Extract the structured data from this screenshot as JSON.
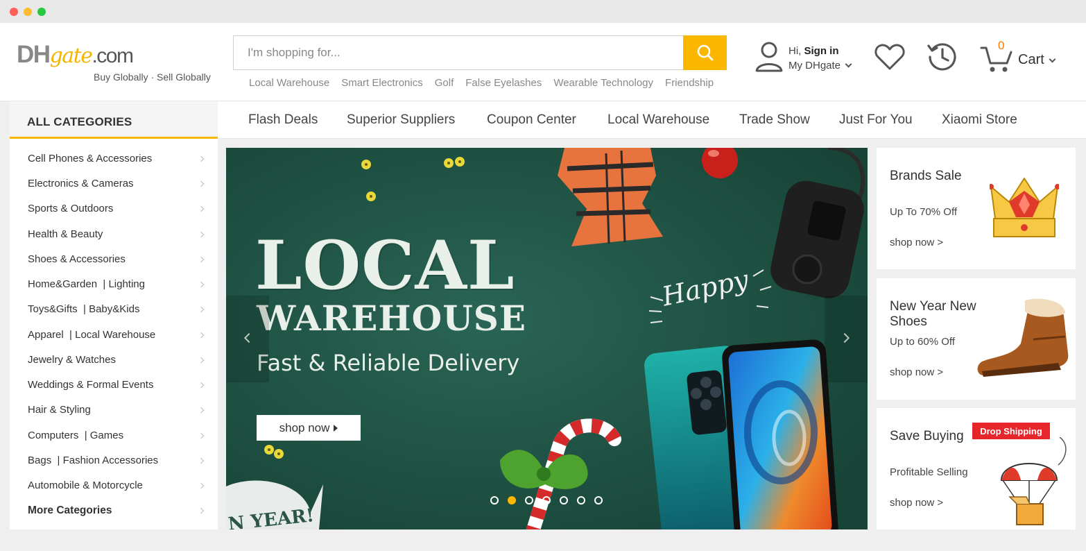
{
  "header": {
    "logo": {
      "dh": "DH",
      "gate": "gate",
      "com": ".com",
      "tagline": "Buy Globally · Sell Globally"
    },
    "search": {
      "placeholder": "I'm shopping for...",
      "value": ""
    },
    "quick_links": [
      "Local Warehouse",
      "Smart Electronics",
      "Golf",
      "False Eyelashes",
      "Wearable Technology",
      "Friendship"
    ],
    "account": {
      "greeting": "Hi, ",
      "sign_in": "Sign in",
      "my": "My DHgate"
    },
    "cart": {
      "count": "0",
      "label": "Cart"
    }
  },
  "categories": {
    "title": "ALL CATEGORIES",
    "items": [
      "Cell Phones & Accessories",
      "Electronics & Cameras",
      "Sports & Outdoors",
      "Health & Beauty",
      "Shoes & Accessories",
      "Home&Garden  | Lighting",
      "Toys&Gifts  | Baby&Kids",
      "Apparel  | Local Warehouse",
      "Jewelry & Watches",
      "Weddings & Formal Events",
      "Hair & Styling",
      "Computers  | Games",
      "Bags  | Fashion Accessories",
      "Automobile & Motorcycle"
    ],
    "more": "More Categories"
  },
  "nav": [
    "Flash Deals",
    "Superior Suppliers",
    "Coupon Center",
    "Local Warehouse",
    "Trade Show",
    "Just For You",
    "Xiaomi Store"
  ],
  "banner": {
    "title1": "LOCAL",
    "title2": "WAREHOUSE",
    "subtitle": "Fast & Reliable Delivery",
    "button": "shop now",
    "happy": "Happy",
    "new_year": "N YEAR!",
    "slides": 7,
    "active_slide": 2
  },
  "promos": [
    {
      "title": "Brands Sale",
      "sub": "Up To 70% Off",
      "link": "shop now >"
    },
    {
      "title": "New Year New Shoes",
      "sub": "Up to 60% Off",
      "link": "shop now >"
    },
    {
      "title": "Save Buying",
      "sub": "Profitable Selling",
      "link": "shop now >",
      "badge": "Drop Shipping"
    }
  ],
  "colors": {
    "accent": "#fbb700",
    "banner_bg": "#205244",
    "cart_count": "#f47a00",
    "badge": "#e6262a"
  }
}
